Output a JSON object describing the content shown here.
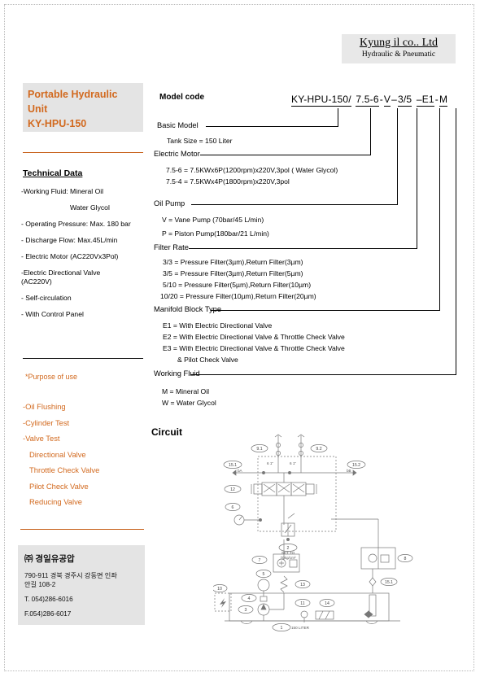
{
  "logo": {
    "company": "Kyung il co.. Ltd",
    "tagline": "Hydraulic & Pneumatic"
  },
  "product": {
    "title_line1": "Portable Hydraulic",
    "title_line2": "Unit",
    "title_line3": "KY-HPU-150",
    "accent_color": "#d2691e"
  },
  "technical_data": {
    "heading": "Technical Data",
    "items": [
      "-Working Fluid: Mineral Oil",
      "Water Glycol",
      "- Operating Pressure: Max. 180 bar",
      "- Discharge Flow:  Max.45L/min",
      "- Electric  Motor  (AC220Vx3Pol)",
      "-Electric  Directional  Valve",
      "(AC220V)",
      "- Self-circulation",
      "- With  Control  Panel"
    ]
  },
  "purpose": {
    "heading": "*Purpose of use",
    "items": [
      "-Oil Flushing",
      "-Cylinder Test",
      "-Valve Test",
      "Directional Valve",
      "Throttle Check Valve",
      "Pilot Check Valve",
      "Reducing Valve"
    ]
  },
  "address": {
    "company": "㈜ 경일유공압",
    "line1": "790-911 경북 경주시 강동면 인좌",
    "line2": "안길 108-2",
    "tel": "T. 054)286-6016",
    "fax": "F.054)286-6017"
  },
  "model_code": {
    "heading": "Model code",
    "code_segments": [
      {
        "text": "KY-HPU-150/",
        "underline": true
      },
      {
        "text": "7.5-6",
        "underline": true
      },
      {
        "text": "-",
        "underline": false
      },
      {
        "text": "V",
        "underline": true
      },
      {
        "text": "–",
        "underline": false
      },
      {
        "text": "3/5",
        "underline": true
      },
      {
        "text": "–E1",
        "underline": true
      },
      {
        "text": "-",
        "underline": false
      },
      {
        "text": "M",
        "underline": true
      }
    ],
    "sections": [
      {
        "label": "Basic Model",
        "items": [
          "Tank Size  = 150 Liter"
        ]
      },
      {
        "label": "Electric Motor",
        "items": [
          "7.5-6  =  7.5KWx6P(1200rpm)x220V,3pol ( Water Glycol)",
          "7.5-4  =  7.5KWx4P(1800rpm)x220V,3pol"
        ]
      },
      {
        "label": "Oil Pump",
        "items": [
          "V  =  Vane Pump (70bar/45 L/min)",
          "P  =  Piston Pump(180bar/21 L/min)"
        ]
      },
      {
        "label": "Filter Rate",
        "items": [
          "3/3  =  Pressure Filter(3µm),Return Filter(3µm)",
          "3/5  =  Pressure Filter(3µm),Return Filter(5µm)",
          "5/10  =  Pressure Filter(5µm),Return Filter(10µm)",
          "10/20 = Pressure Filter(10µm),Return Filter(20µm)"
        ]
      },
      {
        "label": "Manifold Block Type",
        "items": [
          "E1  =  With Electric Directional Valve",
          "E2  =  With Electric Directional Valve & Throttle Check Valve",
          "E3  =  With Electric Directional Valve & Throttle Check Valve",
          "& Pilot Check Valve"
        ]
      },
      {
        "label": "Working Fluid",
        "items": [
          "M            = Mineral Oil",
          "W            = Water Glycol"
        ]
      }
    ]
  },
  "circuit": {
    "heading": "Circuit",
    "tank_label": "150  LITER",
    "relief_setting_line1": "SET  TO",
    "relief_setting_line2": "70kg/cm²",
    "port_labels": [
      "bA",
      "bB"
    ],
    "size_labels": [
      "6 1\"",
      "6 1\""
    ],
    "balloons": [
      "9.1",
      "9.2",
      "15.1",
      "15.2",
      "12",
      "6",
      "2",
      "7",
      "8",
      "13",
      "5",
      "4",
      "3",
      "10",
      "11",
      "14",
      "15.1",
      "1"
    ]
  }
}
